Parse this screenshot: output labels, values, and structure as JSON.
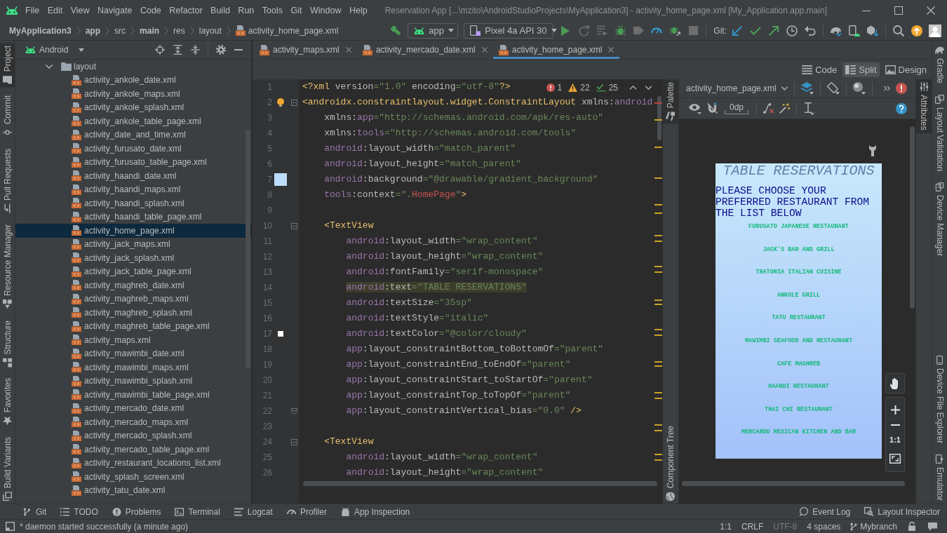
{
  "title_bar": {
    "menu": [
      "File",
      "Edit",
      "View",
      "Navigate",
      "Code",
      "Refactor",
      "Build",
      "Run",
      "Tools",
      "Git",
      "Window",
      "Help"
    ],
    "title": "Reservation App [...\\mzito\\AndroidStudioProjects\\MyApplication3] - activity_home_page.xml [My_Application.app.main]"
  },
  "nav_bar": {
    "breadcrumbs": [
      {
        "label": "MyApplication3",
        "kind": "module"
      },
      {
        "label": "app",
        "kind": "module"
      },
      {
        "label": "src",
        "kind": "dir"
      },
      {
        "label": "main",
        "kind": "module"
      },
      {
        "label": "res",
        "kind": "dir"
      },
      {
        "label": "layout",
        "kind": "dir"
      },
      {
        "label": "activity_home_page.xml",
        "kind": "file"
      }
    ],
    "run_config": "app",
    "device": "Pixel 4a API 30",
    "git_label": "Git:"
  },
  "left_tool_strip": {
    "top": [
      {
        "label": "Project",
        "selected": true
      },
      {
        "label": "Commit",
        "selected": false
      },
      {
        "label": "Pull Requests",
        "selected": false
      },
      {
        "label": "Resource Manager",
        "selected": false
      }
    ],
    "bottom": [
      {
        "label": "Structure",
        "selected": false
      },
      {
        "label": "Favorites",
        "selected": false
      },
      {
        "label": "Build Variants",
        "selected": false
      }
    ]
  },
  "project_panel": {
    "view": "Android",
    "tree": [
      {
        "label": "layout",
        "expanded": true,
        "selected": false,
        "children": [
          {
            "label": "activity_ankole_date.xml",
            "selected": false
          },
          {
            "label": "activity_ankole_maps.xml",
            "selected": false
          },
          {
            "label": "activity_ankole_splash.xml",
            "selected": false
          },
          {
            "label": "activity_ankole_table_page.xml",
            "selected": false
          },
          {
            "label": "activity_date_and_time.xml",
            "selected": false
          },
          {
            "label": "activity_furusato_date.xml",
            "selected": false
          },
          {
            "label": "activity_furusato_table_page.xml",
            "selected": false
          },
          {
            "label": "activity_haandi_date.xml",
            "selected": false
          },
          {
            "label": "activity_haandi_maps.xml",
            "selected": false
          },
          {
            "label": "activity_haandi_splash.xml",
            "selected": false
          },
          {
            "label": "activity_haandi_table_page.xml",
            "selected": false
          },
          {
            "label": "activity_home_page.xml",
            "selected": true
          },
          {
            "label": "activity_jack_maps.xml",
            "selected": false
          },
          {
            "label": "activity_jack_splash.xml",
            "selected": false
          },
          {
            "label": "activity_jack_table_page.xml",
            "selected": false
          },
          {
            "label": "activity_maghreb_date.xml",
            "selected": false
          },
          {
            "label": "activity_maghreb_maps.xml",
            "selected": false
          },
          {
            "label": "activity_maghreb_splash.xml",
            "selected": false
          },
          {
            "label": "activity_maghreb_table_page.xml",
            "selected": false
          },
          {
            "label": "activity_maps.xml",
            "selected": false
          },
          {
            "label": "activity_mawimbi_date.xml",
            "selected": false
          },
          {
            "label": "activity_mawimbi_maps.xml",
            "selected": false
          },
          {
            "label": "activity_mawimbi_splash.xml",
            "selected": false
          },
          {
            "label": "activity_mawimbi_table_page.xml",
            "selected": false
          },
          {
            "label": "activity_mercado_date.xml",
            "selected": false
          },
          {
            "label": "activity_mercado_maps.xml",
            "selected": false
          },
          {
            "label": "activity_mercado_splash.xml",
            "selected": false
          },
          {
            "label": "activity_mercado_table_page.xml",
            "selected": false
          },
          {
            "label": "activity_restaurant_locations_list.xml",
            "selected": false
          },
          {
            "label": "activity_splash_screen.xml",
            "selected": false
          },
          {
            "label": "activity_tatu_date.xml",
            "selected": false
          }
        ]
      }
    ]
  },
  "editor": {
    "tabs": [
      {
        "label": "activity_maps.xml",
        "selected": false
      },
      {
        "label": "activity_mercado_date.xml",
        "selected": false
      },
      {
        "label": "activity_home_page.xml",
        "selected": true
      }
    ],
    "view_modes": [
      {
        "label": "Code",
        "selected": false
      },
      {
        "label": "Split",
        "selected": true
      },
      {
        "label": "Design",
        "selected": false
      }
    ],
    "inspections": {
      "errors": "1",
      "warnings": "22",
      "weak_warnings": "25"
    },
    "lines": [
      {
        "number": "1",
        "highlighted": false,
        "tokens": [
          {
            "kind": "tag",
            "text": "<?xml"
          },
          {
            "kind": "attr",
            "text": " version"
          },
          {
            "kind": "str",
            "text": "=\"1.0\""
          },
          {
            "kind": "attr",
            "text": " encoding"
          },
          {
            "kind": "str",
            "text": "=\"utf-8\""
          },
          {
            "kind": "tag",
            "text": "?>"
          }
        ]
      },
      {
        "number": "2",
        "highlighted": false,
        "fold": {
          "kind": "start",
          "expanded": true
        },
        "gutter_icon": {
          "kind": "bulb"
        },
        "tokens": [
          {
            "kind": "tag",
            "text": "<androidx.constraintlayout.widget.ConstraintLayout"
          },
          {
            "kind": "attr",
            "text": " xmlns:"
          },
          {
            "kind": "ns",
            "text": "android"
          }
        ]
      },
      {
        "number": "3",
        "highlighted": false,
        "tokens": [
          {
            "kind": "attr",
            "text": "    xmlns:"
          },
          {
            "kind": "ns",
            "text": "app"
          },
          {
            "kind": "str",
            "text": "=\"http://schemas.android.com/apk/res-auto\""
          }
        ]
      },
      {
        "number": "4",
        "highlighted": false,
        "tokens": [
          {
            "kind": "attr",
            "text": "    xmlns:"
          },
          {
            "kind": "ns",
            "text": "tools"
          },
          {
            "kind": "str",
            "text": "=\"http://schemas.android.com/tools\""
          }
        ]
      },
      {
        "number": "5",
        "highlighted": false,
        "tokens": [
          {
            "kind": "ns",
            "text": "    android"
          },
          {
            "kind": "attr",
            "text": ":layout_width"
          },
          {
            "kind": "str",
            "text": "=\"match_parent\""
          }
        ]
      },
      {
        "number": "6",
        "highlighted": false,
        "tokens": [
          {
            "kind": "ns",
            "text": "    android"
          },
          {
            "kind": "attr",
            "text": ":layout_height"
          },
          {
            "kind": "str",
            "text": "=\"match_parent\""
          }
        ]
      },
      {
        "number": "7",
        "highlighted": false,
        "gutter_icon": {
          "kind": "drawable",
          "color": "#bcdcfb"
        },
        "tokens": [
          {
            "kind": "ns",
            "text": "    android"
          },
          {
            "kind": "attr",
            "text": ":background"
          },
          {
            "kind": "str",
            "text": "=\"@drawable/gradient_background\""
          }
        ]
      },
      {
        "number": "8",
        "highlighted": false,
        "tokens": [
          {
            "kind": "ns",
            "text": "    tools"
          },
          {
            "kind": "attr",
            "text": ":context"
          },
          {
            "kind": "str",
            "text": "=\"."
          },
          {
            "kind": "err",
            "text": "HomePage"
          },
          {
            "kind": "str",
            "text": "\""
          },
          {
            "kind": "tag",
            "text": ">"
          }
        ]
      },
      {
        "number": "9",
        "highlighted": false
      },
      {
        "number": "10",
        "highlighted": false,
        "fold": {
          "kind": "start",
          "expanded": true
        },
        "tokens": [
          {
            "kind": "tag",
            "text": "    <TextView"
          }
        ]
      },
      {
        "number": "11",
        "highlighted": false,
        "tokens": [
          {
            "kind": "ns",
            "text": "        android"
          },
          {
            "kind": "attr",
            "text": ":layout_width"
          },
          {
            "kind": "str",
            "text": "=\"wrap_content\""
          }
        ]
      },
      {
        "number": "12",
        "highlighted": false,
        "tokens": [
          {
            "kind": "ns",
            "text": "        android"
          },
          {
            "kind": "attr",
            "text": ":layout_height"
          },
          {
            "kind": "str",
            "text": "=\"wrap_content\""
          }
        ]
      },
      {
        "number": "13",
        "highlighted": false,
        "tokens": [
          {
            "kind": "ns",
            "text": "        android"
          },
          {
            "kind": "attr",
            "text": ":fontFamily"
          },
          {
            "kind": "str",
            "text": "=\"serif-monospace\""
          }
        ]
      },
      {
        "number": "14",
        "highlighted": true,
        "tokens": [
          {
            "kind": "ns",
            "text": "        android"
          },
          {
            "kind": "attr",
            "text": ":text"
          },
          {
            "kind": "str",
            "text": "=\"TABLE RESERVATIONS\""
          }
        ]
      },
      {
        "number": "15",
        "highlighted": false,
        "tokens": [
          {
            "kind": "ns",
            "text": "        android"
          },
          {
            "kind": "attr",
            "text": ":textSize"
          },
          {
            "kind": "str",
            "text": "=\"35sp\""
          }
        ]
      },
      {
        "number": "16",
        "highlighted": false,
        "tokens": [
          {
            "kind": "ns",
            "text": "        android"
          },
          {
            "kind": "attr",
            "text": ":textStyle"
          },
          {
            "kind": "str",
            "text": "=\"italic\""
          }
        ]
      },
      {
        "number": "17",
        "highlighted": false,
        "gutter_icon": {
          "kind": "color",
          "color": "#ffffff"
        },
        "tokens": [
          {
            "kind": "ns",
            "text": "        android"
          },
          {
            "kind": "attr",
            "text": ":textColor"
          },
          {
            "kind": "str",
            "text": "=\"@color/cloudy\""
          }
        ]
      },
      {
        "number": "18",
        "highlighted": false,
        "tokens": [
          {
            "kind": "ns",
            "text": "        app"
          },
          {
            "kind": "attr",
            "text": ":layout_constraintBottom_toBottomOf"
          },
          {
            "kind": "str",
            "text": "=\"parent\""
          }
        ]
      },
      {
        "number": "19",
        "highlighted": false,
        "tokens": [
          {
            "kind": "ns",
            "text": "        app"
          },
          {
            "kind": "attr",
            "text": ":layout_constraintEnd_toEndOf"
          },
          {
            "kind": "str",
            "text": "=\"parent\""
          }
        ]
      },
      {
        "number": "20",
        "highlighted": false,
        "tokens": [
          {
            "kind": "ns",
            "text": "        app"
          },
          {
            "kind": "attr",
            "text": ":layout_constraintStart_toStartOf"
          },
          {
            "kind": "str",
            "text": "=\"parent\""
          }
        ]
      },
      {
        "number": "21",
        "highlighted": false,
        "tokens": [
          {
            "kind": "ns",
            "text": "        app"
          },
          {
            "kind": "attr",
            "text": ":layout_constraintTop_toTopOf"
          },
          {
            "kind": "str",
            "text": "=\"parent\""
          }
        ]
      },
      {
        "number": "22",
        "highlighted": false,
        "fold": {
          "kind": "end"
        },
        "tokens": [
          {
            "kind": "ns",
            "text": "        app"
          },
          {
            "kind": "attr",
            "text": ":layout_constraintVertical_bias"
          },
          {
            "kind": "str",
            "text": "=\"0.0\""
          },
          {
            "kind": "tag",
            "text": " />"
          }
        ]
      },
      {
        "number": "23",
        "highlighted": false
      },
      {
        "number": "24",
        "highlighted": false,
        "fold": {
          "kind": "start",
          "expanded": true
        },
        "tokens": [
          {
            "kind": "tag",
            "text": "    <TextView"
          }
        ]
      },
      {
        "number": "25",
        "highlighted": false,
        "tokens": [
          {
            "kind": "ns",
            "text": "        android"
          },
          {
            "kind": "attr",
            "text": ":layout_width"
          },
          {
            "kind": "str",
            "text": "=\"wrap_content\""
          }
        ]
      },
      {
        "number": "26",
        "highlighted": false,
        "tokens": [
          {
            "kind": "ns",
            "text": "        android"
          },
          {
            "kind": "attr",
            "text": ":layout_height"
          },
          {
            "kind": "str",
            "text": "=\"wrap_content\""
          }
        ]
      }
    ]
  },
  "preview": {
    "left_tabs": [
      {
        "label": "Palette",
        "selected": true
      },
      {
        "label": "Component Tree",
        "selected": false
      }
    ],
    "right_tabs": [
      {
        "label": "Attributes",
        "selected": true
      }
    ],
    "file": "activity_home_page.xml",
    "margin": "0dp",
    "zoom_reset": "1:1",
    "phone": {
      "title": "TABLE RESERVATIONS",
      "prompt": "PLEASE CHOOSE YOUR PREFERRED RESTAURANT FROM THE LIST BELOW",
      "restaurants": [
        "FURUSATO JAPANESE RESTAURANT",
        "JACK'S BAR AND GRILL",
        "TRATORIA ITALIAN CUISINE",
        "ANKOLE GRILL",
        "TATU RESTAURANT",
        "MAWIMBI SEAFOOD AND RESTAURANT",
        "CAFE MAGHREB",
        "HAANDI RESTAURANT",
        "THAI CHI RESTAURANT",
        "MERCARDO MEXICAN KITCHEN AND BAR"
      ]
    }
  },
  "right_tool_strip": {
    "top": [
      {
        "label": "Gradle"
      },
      {
        "label": "Layout Validation"
      },
      {
        "label": "Device Manager"
      }
    ],
    "bottom": [
      {
        "label": "Device File Explorer"
      },
      {
        "label": "Emulator"
      }
    ]
  },
  "bottom_tool_bar": {
    "left": [
      "Git",
      "TODO",
      "Problems",
      "Terminal",
      "Logcat",
      "Profiler",
      "App Inspection"
    ],
    "right": [
      "Event Log",
      "Layout Inspector"
    ]
  },
  "status_bar": {
    "message": "* daemon started successfully (a minute ago)",
    "widgets": [
      {
        "label": "1:1",
        "kind": "text",
        "disabled": false
      },
      {
        "label": "CRLF",
        "kind": "text",
        "disabled": false
      },
      {
        "label": "UTF-8",
        "kind": "text",
        "disabled": true
      },
      {
        "label": "4 spaces",
        "kind": "text",
        "disabled": false
      },
      {
        "label": "Mybranch",
        "kind": "branch",
        "disabled": false
      }
    ]
  }
}
